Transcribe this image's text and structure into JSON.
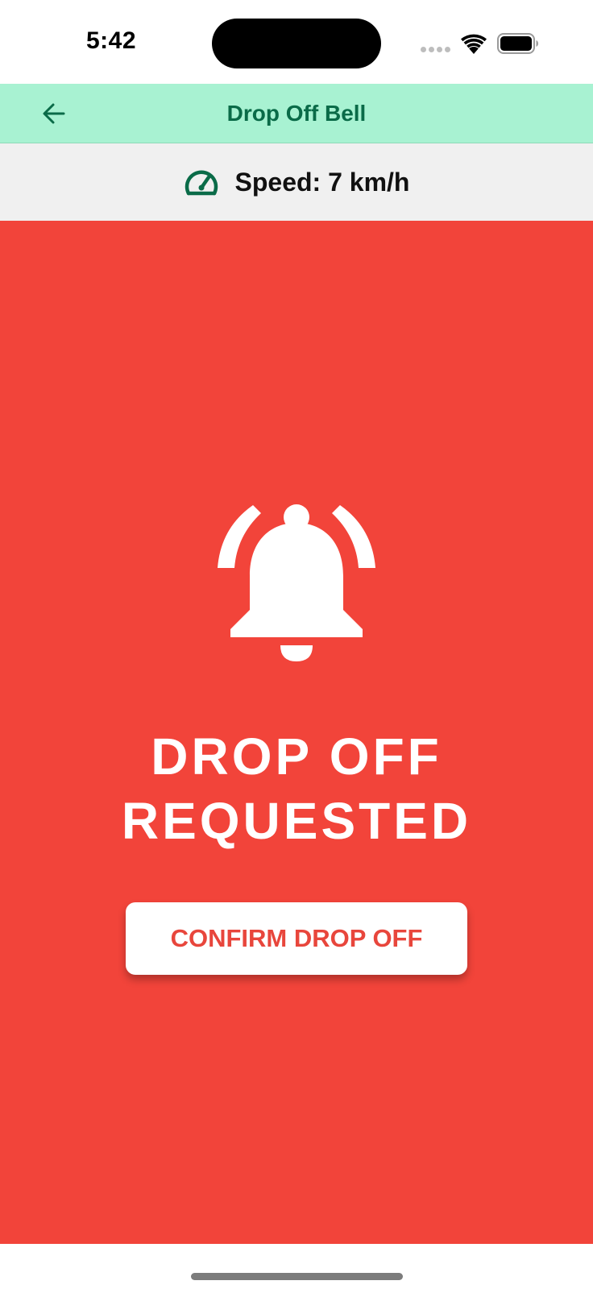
{
  "status_bar": {
    "time": "5:42"
  },
  "app_bar": {
    "title": "Drop Off Bell",
    "back_icon": "arrow-left-icon",
    "background": "#a8f2d2",
    "title_color": "#0a6b48"
  },
  "speed": {
    "icon": "speedometer-icon",
    "text": "Speed: 7 km/h"
  },
  "alert": {
    "icon": "ringing-bell-icon",
    "title_line1": "DROP OFF",
    "title_line2": "REQUESTED",
    "background": "#f2443a",
    "confirm_label": "CONFIRM DROP OFF",
    "confirm_color": "#e8463c"
  }
}
